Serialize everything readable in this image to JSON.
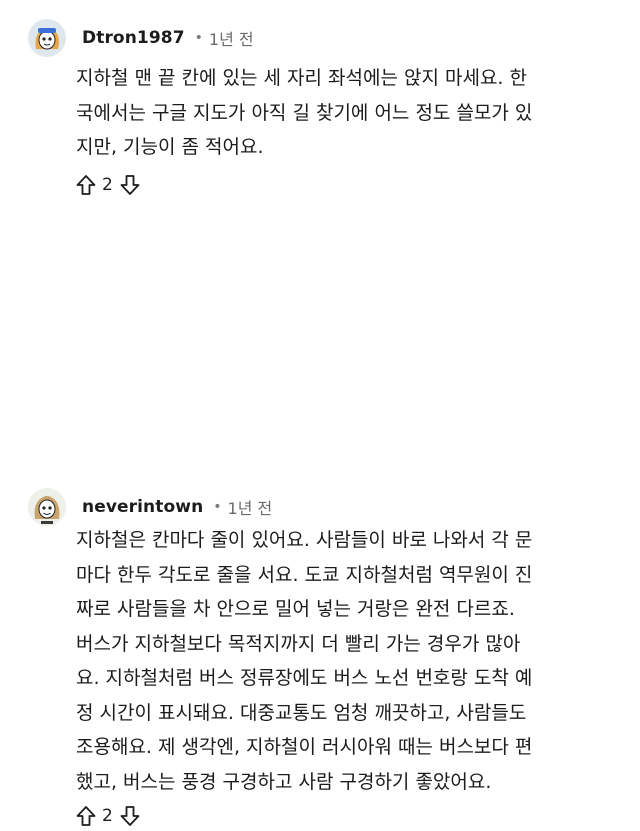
{
  "comments": [
    {
      "username": "Dtron1987",
      "separator": "•",
      "time": "1년 전",
      "lines": [
        "지하철 맨 끝 칸에 있는 세 자리 좌석에는 앉지 마세요. 한",
        "국에서는 구글 지도가 아직 길 찾기에 어느 정도 쓸모가 있",
        "지만, 기능이 좀 적어요."
      ],
      "score": "2",
      "avatar_icon": "reddit-avatar-icon"
    },
    {
      "username": "neverintown",
      "separator": "•",
      "time": "1년 전",
      "lines": [
        "지하철은 칸마다 줄이 있어요. 사람들이 바로 나와서 각 문",
        "마다 한두 각도로 줄을 서요. 도쿄 지하철처럼 역무원이 진",
        "짜로 사람들을 차 안으로 밀어 넣는 거랑은 완전 다르죠.",
        "버스가 지하철보다 목적지까지 더 빨리 가는 경우가 많아",
        "요. 지하철처럼 버스 정류장에도 버스 노선 번호랑 도착 예",
        "정 시간이 표시돼요. 대중교통도 엄청 깨끗하고, 사람들도",
        "조용해요. 제 생각엔, 지하철이 러시아워 때는 버스보다 편",
        "했고, 버스는 풍경 구경하고 사람 구경하기 좋았어요."
      ],
      "score": "2",
      "avatar_icon": "reddit-avatar-icon"
    }
  ],
  "colors": {
    "text": "#1c1c1c",
    "meta": "#6b6b6b",
    "background": "#ffffff"
  },
  "icons": {
    "upvote": "arrow-up-outline-icon",
    "downvote": "arrow-down-outline-icon"
  }
}
